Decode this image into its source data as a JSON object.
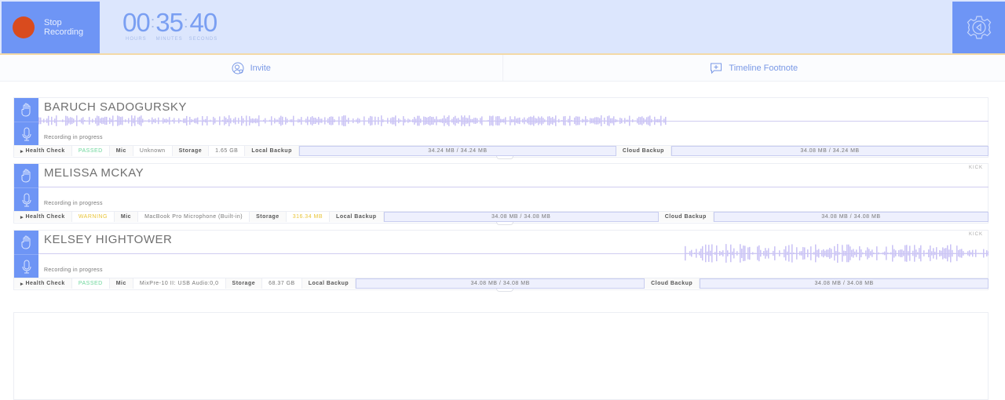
{
  "header": {
    "stop_label_1": "Stop",
    "stop_label_2": "Recording",
    "hours": "00",
    "minutes": "35",
    "seconds": "40",
    "hours_label": "HOURS",
    "minutes_label": "MINUTES",
    "seconds_label": "SECONDS"
  },
  "toolbar": {
    "invite": "Invite",
    "footnote": "Timeline Footnote"
  },
  "labels": {
    "health": "Health Check",
    "mic": "Mic",
    "storage": "Storage",
    "local": "Local Backup",
    "cloud": "Cloud Backup",
    "kick": "KICK"
  },
  "colors": {
    "accent": "#6e95f5",
    "passed": "#6cd69b",
    "warning": "#e9c53a",
    "wave": "#c9c2f5"
  },
  "participants": [
    {
      "name": "BARUCH SADOGURSKY",
      "status": "Recording in progress",
      "health": "PASSED",
      "mic": "Unknown",
      "storage": "1.65 GB",
      "local": "34.24 MB / 34.24 MB",
      "cloud": "34.08 MB / 34.24 MB",
      "kick": false,
      "wave_start": 0,
      "wave_end": 0.66
    },
    {
      "name": "MELISSA MCKAY",
      "status": "Recording in progress",
      "health": "WARNING",
      "mic": "MacBook Pro Microphone (Built-in)",
      "storage": "316.34 MB",
      "local": "34.08 MB / 34.08 MB",
      "cloud": "34.08 MB / 34.08 MB",
      "kick": true,
      "wave_start": 0,
      "wave_end": 0
    },
    {
      "name": "KELSEY HIGHTOWER",
      "status": "Recording in progress",
      "health": "PASSED",
      "mic": "MixPre-10 II: USB Audio:0,0",
      "storage": "68.37 GB",
      "local": "34.08 MB / 34.08 MB",
      "cloud": "34.08 MB / 34.08 MB",
      "kick": true,
      "wave_start": 0.68,
      "wave_end": 1.0
    }
  ]
}
